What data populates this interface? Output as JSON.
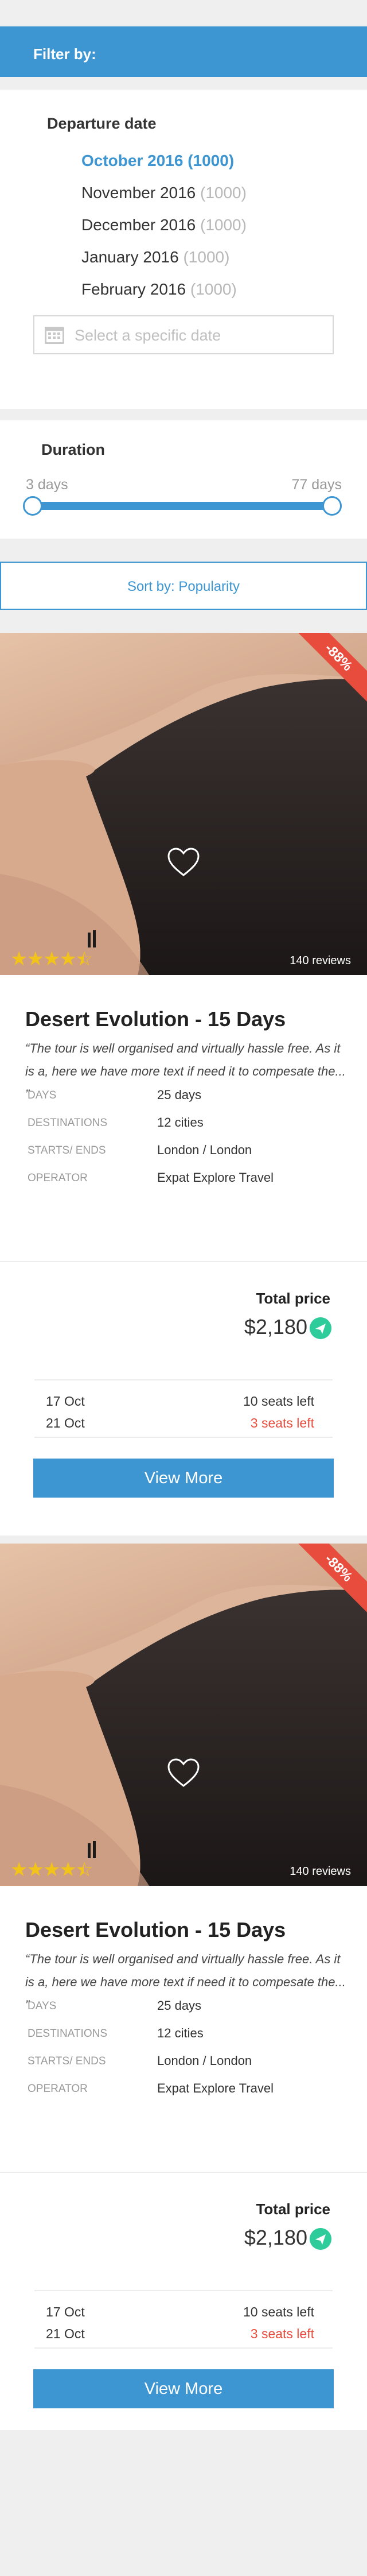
{
  "filter": {
    "header_label": "Filter by:",
    "departure": {
      "title": "Departure date",
      "options": [
        {
          "month": "October 2016",
          "count": "(1000)",
          "selected": true
        },
        {
          "month": "November 2016",
          "count": "(1000)",
          "selected": false
        },
        {
          "month": "December 2016",
          "count": "(1000)",
          "selected": false
        },
        {
          "month": "January 2016",
          "count": "(1000)",
          "selected": false
        },
        {
          "month": "February 2016",
          "count": "(1000)",
          "selected": false
        }
      ],
      "date_placeholder": "Select a specific date"
    },
    "duration": {
      "title": "Duration",
      "min_label": "3 days",
      "max_label": "77 days"
    }
  },
  "sort": {
    "label": "Sort by: Popularity"
  },
  "colors": {
    "accent": "#3d96d2",
    "discount": "#e74c3c",
    "stars": "#f2c318",
    "price_icon": "#2ecc9b"
  },
  "tours": [
    {
      "discount": "-88%",
      "rating": 4.5,
      "reviews": "140 reviews",
      "name": "Desert Evolution - 15 Days",
      "quote": "“The tour is well organised and virtually hassle free. As it is a, here we have more text if need it to compesate the... ”",
      "specs": [
        {
          "label": "DAYS",
          "value": "25 days"
        },
        {
          "label": "DESTINATIONS",
          "value": "12 cities"
        },
        {
          "label": "STARTS/ ENDS",
          "value": "London / London"
        },
        {
          "label": "OPERATOR",
          "value": "Expat Explore Travel"
        }
      ],
      "price_label": "Total price",
      "price": "$2,180",
      "departures": [
        {
          "date": "17 Oct",
          "seats": "10 seats left"
        },
        {
          "date": "21 Oct",
          "seats": "3 seats left"
        }
      ],
      "button_label": "View More"
    },
    {
      "discount": "-88%",
      "rating": 4.5,
      "reviews": "140 reviews",
      "name": "Desert Evolution - 15 Days",
      "quote": "“The tour is well organised and virtually hassle free. As it is a, here we have more text if need it to compesate the... ”",
      "specs": [
        {
          "label": "DAYS",
          "value": "25 days"
        },
        {
          "label": "DESTINATIONS",
          "value": "12 cities"
        },
        {
          "label": "STARTS/ ENDS",
          "value": "London / London"
        },
        {
          "label": "OPERATOR",
          "value": "Expat Explore Travel"
        }
      ],
      "price_label": "Total price",
      "price": "$2,180",
      "departures": [
        {
          "date": "17 Oct",
          "seats": "10 seats left"
        },
        {
          "date": "21 Oct",
          "seats": "3 seats left"
        }
      ],
      "button_label": "View More"
    }
  ]
}
